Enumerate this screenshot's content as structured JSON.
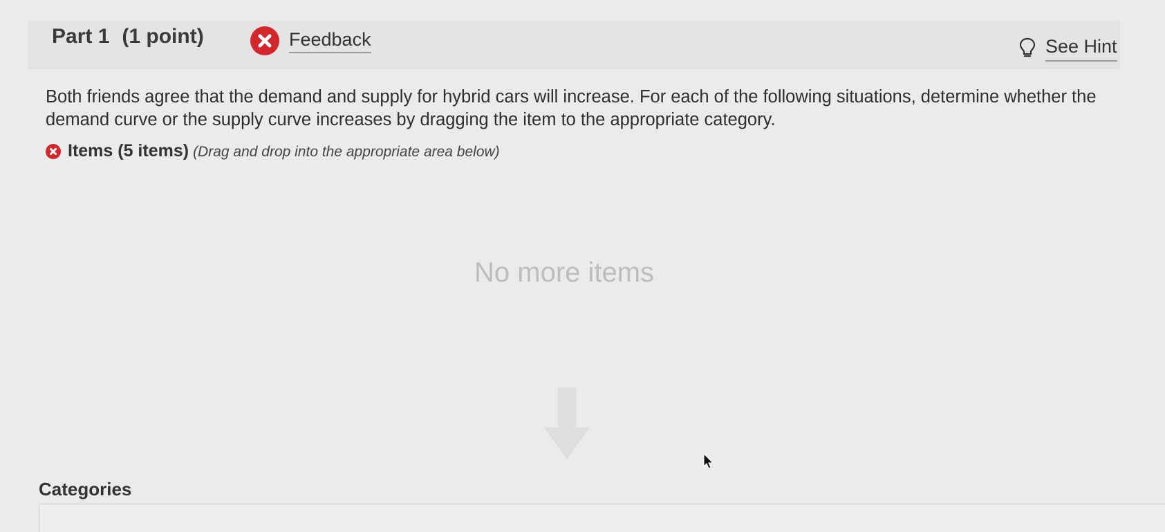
{
  "part": {
    "title": "Part 1",
    "points": "(1 point)"
  },
  "feedback": {
    "label": "Feedback",
    "icon": "error-x-icon",
    "color": "#d3262d"
  },
  "hint": {
    "label": "See Hint",
    "icon": "lightbulb-icon"
  },
  "question": {
    "text": "Both friends agree that the demand and supply for hybrid cars will increase. For each of the following situations, determine whether the demand curve or the supply curve increases by dragging the item to the appropriate category."
  },
  "items": {
    "title": "Items (5 items)",
    "hint": "(Drag and drop into the appropriate area below)",
    "empty_message": "No more items"
  },
  "categories": {
    "title": "Categories"
  }
}
